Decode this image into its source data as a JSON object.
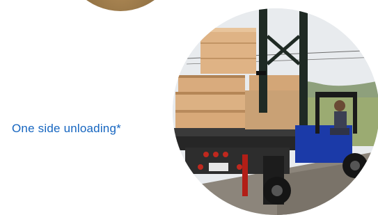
{
  "caption": "One side unloading*",
  "colors": {
    "caption": "#1565c0",
    "forklift_blue": "#1b3aa8",
    "lumber": "#d9ae7a",
    "mast": "#1f2a24"
  },
  "images": [
    {
      "name": "top-circular-photo",
      "subject": "partially visible photo"
    },
    {
      "name": "unloading-photo",
      "subject": "truck-mounted forklift unloading lumber from a flatbed truck"
    }
  ]
}
